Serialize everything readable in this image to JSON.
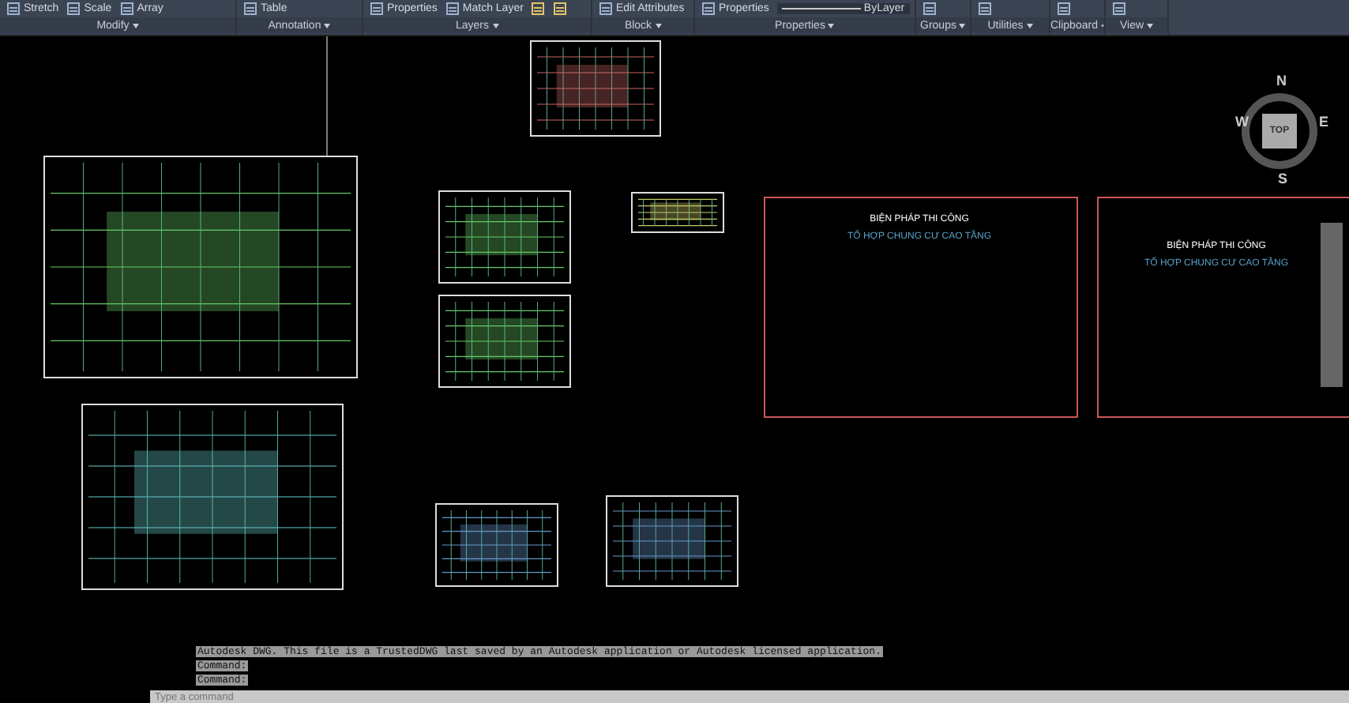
{
  "ribbon": {
    "panels": [
      {
        "label": "Modify",
        "items": [
          "Stretch",
          "Scale",
          "Array"
        ]
      },
      {
        "label": "Annotation",
        "items": [
          "Table"
        ]
      },
      {
        "label": "Layers",
        "items": [
          "Properties",
          "Match Layer"
        ]
      },
      {
        "label": "Block",
        "items": [
          "Edit Attributes"
        ]
      },
      {
        "label": "Properties",
        "items": [
          "Properties",
          "ByLayer"
        ]
      },
      {
        "label": "Groups"
      },
      {
        "label": "Utilities"
      },
      {
        "label": "Clipboard"
      },
      {
        "label": "View"
      }
    ]
  },
  "view_cube": {
    "face": "TOP",
    "north": "N",
    "south": "S",
    "east": "E",
    "west": "W"
  },
  "title_sheets": [
    {
      "title": "BIỆN PHÁP THI CÔNG",
      "subtitle": "TỔ HỢP CHUNG CƯ CAO TẦNG"
    },
    {
      "title": "BIỆN PHÁP THI CÔNG",
      "subtitle": "TỔ HỢP CHUNG CƯ CAO TẦNG"
    }
  ],
  "command_history": [
    "Autodesk DWG.  This file is a TrustedDWG last saved by an Autodesk application or Autodesk licensed application.",
    "Command:",
    "Command:"
  ],
  "command_line": {
    "placeholder": "Type a command"
  }
}
